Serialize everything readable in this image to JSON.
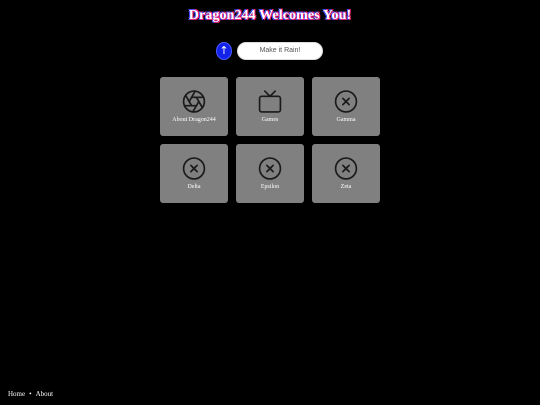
{
  "header": {
    "title": "Dragon244 Welcomes You!"
  },
  "controls": {
    "up_label": "↑",
    "rain_label": "Make it Rain!"
  },
  "tiles": [
    {
      "label": "About Dragon244",
      "icon": "aperture-icon"
    },
    {
      "label": "Games",
      "icon": "tv-icon"
    },
    {
      "label": "Gamma",
      "icon": "x-circle-icon"
    },
    {
      "label": "Delta",
      "icon": "x-circle-icon"
    },
    {
      "label": "Epsilon",
      "icon": "x-circle-icon"
    },
    {
      "label": "Zeta",
      "icon": "x-circle-icon"
    }
  ],
  "footer": {
    "home_label": "Home",
    "separator": "•",
    "about_label": "About"
  },
  "colors": {
    "background": "#000000",
    "tile": "#808080",
    "up_button": "#1222e8",
    "title_shadow_pink": "#ff1f6b",
    "title_shadow_blue": "#3b4bff"
  }
}
